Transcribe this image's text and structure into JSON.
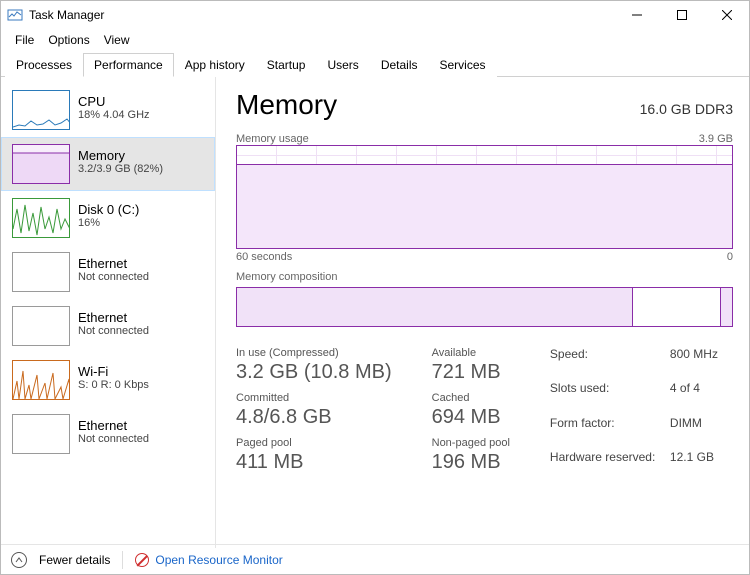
{
  "window": {
    "title": "Task Manager"
  },
  "menu": {
    "file": "File",
    "options": "Options",
    "view": "View"
  },
  "tabs": {
    "processes": "Processes",
    "performance": "Performance",
    "app_history": "App history",
    "startup": "Startup",
    "users": "Users",
    "details": "Details",
    "services": "Services"
  },
  "sidebar": {
    "cpu": {
      "name": "CPU",
      "sub": "18% 4.04 GHz"
    },
    "memory": {
      "name": "Memory",
      "sub": "3.2/3.9 GB (82%)"
    },
    "disk": {
      "name": "Disk 0 (C:)",
      "sub": "16%"
    },
    "eth1": {
      "name": "Ethernet",
      "sub": "Not connected"
    },
    "eth2": {
      "name": "Ethernet",
      "sub": "Not connected"
    },
    "wifi": {
      "name": "Wi-Fi",
      "sub": "S: 0 R: 0 Kbps"
    },
    "eth3": {
      "name": "Ethernet",
      "sub": "Not connected"
    }
  },
  "main": {
    "title": "Memory",
    "capacity": "16.0 GB DDR3",
    "chart1_label_left": "Memory usage",
    "chart1_label_right": "3.9 GB",
    "axis_left": "60 seconds",
    "axis_right": "0",
    "comp_label": "Memory composition"
  },
  "stats": {
    "inuse_label": "In use (Compressed)",
    "inuse_value": "3.2 GB (10.8 MB)",
    "avail_label": "Available",
    "avail_value": "721 MB",
    "committed_label": "Committed",
    "committed_value": "4.8/6.8 GB",
    "cached_label": "Cached",
    "cached_value": "694 MB",
    "paged_label": "Paged pool",
    "paged_value": "411 MB",
    "nonpaged_label": "Non-paged pool",
    "nonpaged_value": "196 MB"
  },
  "kv": {
    "speed_label": "Speed:",
    "speed_value": "800 MHz",
    "slots_label": "Slots used:",
    "slots_value": "4 of 4",
    "form_label": "Form factor:",
    "form_value": "DIMM",
    "hw_label": "Hardware reserved:",
    "hw_value": "12.1 GB"
  },
  "footer": {
    "fewer": "Fewer details",
    "resmon": "Open Resource Monitor"
  },
  "chart_data": {
    "type": "area",
    "title": "Memory usage",
    "ylim": [
      0,
      3.9
    ],
    "xlabel": "60 seconds → 0",
    "series": [
      {
        "name": "In use (GB)",
        "approx_constant": 3.2
      }
    ],
    "composition": {
      "in_use_gb": 3.2,
      "available_gb": 0.721,
      "total_visible_gb": 3.9
    }
  }
}
